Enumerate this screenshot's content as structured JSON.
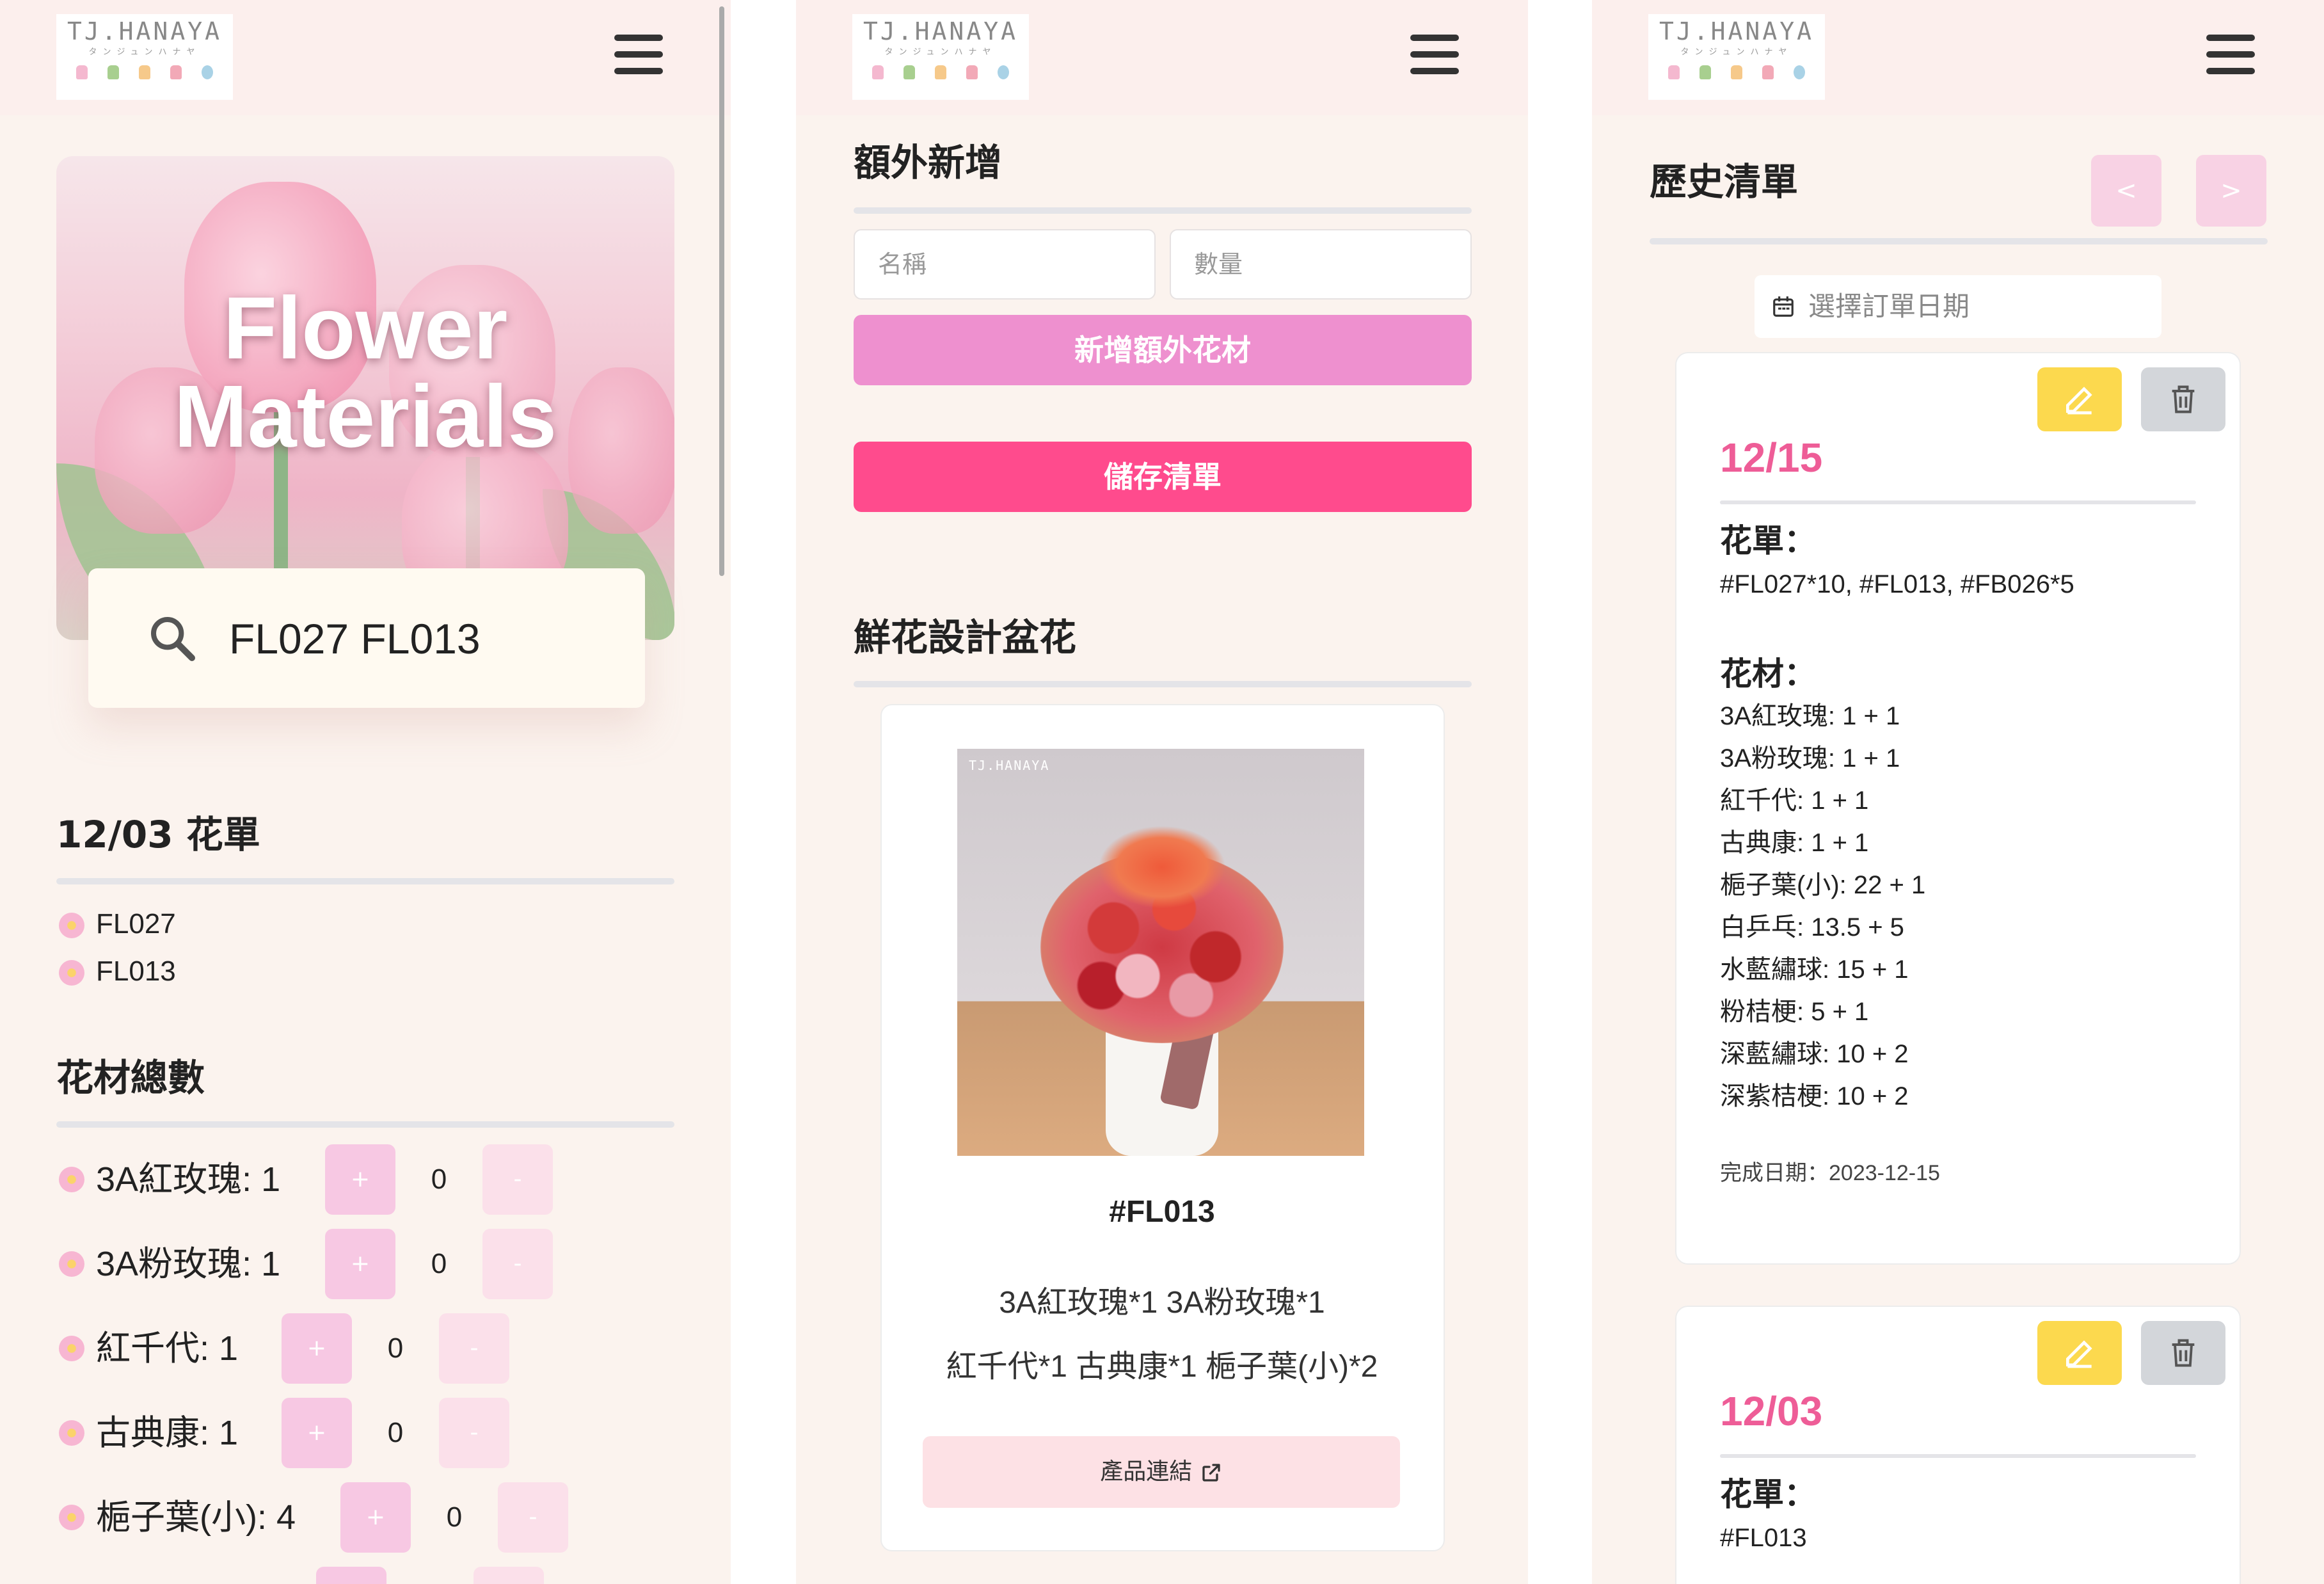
{
  "brand": {
    "name": "TJ.HANAYA",
    "kana": "タンジュンハナヤ"
  },
  "panel1": {
    "hero_title": "Flower Materials",
    "search_value": "FL027 FL013",
    "order_title": "12/03 花單",
    "order_items": [
      "FL027",
      "FL013"
    ],
    "materials_title": "花材總數",
    "materials": [
      {
        "name": "3A紅玫瑰",
        "count": "1",
        "extra": "0"
      },
      {
        "name": "3A粉玫瑰",
        "count": "1",
        "extra": "0"
      },
      {
        "name": "紅千代",
        "count": "1",
        "extra": "0"
      },
      {
        "name": "古典康",
        "count": "1",
        "extra": "0"
      },
      {
        "name": "梔子葉(小)",
        "count": "4",
        "extra": "0"
      }
    ],
    "plus_label": "+",
    "minus_label": "-"
  },
  "panel2": {
    "extra_title": "額外新增",
    "name_placeholder": "名稱",
    "qty_placeholder": "數量",
    "add_button": "新增額外花材",
    "save_button": "儲存清單",
    "design_title": "鮮花設計盆花",
    "product": {
      "photo_watermark": "TJ.HANAYA",
      "code": "#FL013",
      "recipe_line1": "3A紅玫瑰*1 3A粉玫瑰*1",
      "recipe_line2": "紅千代*1 古典康*1 梔子葉(小)*2",
      "link_label": "產品連結"
    }
  },
  "panel3": {
    "history_title": "歷史清單",
    "prev_label": "<",
    "next_label": ">",
    "date_placeholder": "選擇訂單日期",
    "orders_label": "花單：",
    "materials_label": "花材：",
    "done_prefix": "完成日期：",
    "cards": [
      {
        "date": "12/15",
        "orders": "#FL027*10, #FL013, #FB026*5",
        "materials": [
          "3A紅玫瑰: 1 + 1",
          "3A粉玫瑰: 1 + 1",
          "紅千代: 1 + 1",
          "古典康: 1 + 1",
          "梔子葉(小): 22 + 1",
          "白乒乓: 13.5 + 5",
          "水藍繡球: 15 + 1",
          "粉桔梗: 5 + 1",
          "深藍繡球: 10 + 2",
          "深紫桔梗: 10 + 2"
        ],
        "done_date": "2023-12-15"
      },
      {
        "date": "12/03",
        "orders": "#FL013"
      }
    ]
  },
  "colors": {
    "page_bg": "#fbf3ee",
    "header_bg": "#fcefed",
    "accent_pink": "#ff4b8d",
    "soft_pink": "#ee90cf",
    "date_pink": "#ee5d97",
    "edit_yellow": "#fcd94e",
    "delete_gray": "#d3d6da"
  }
}
